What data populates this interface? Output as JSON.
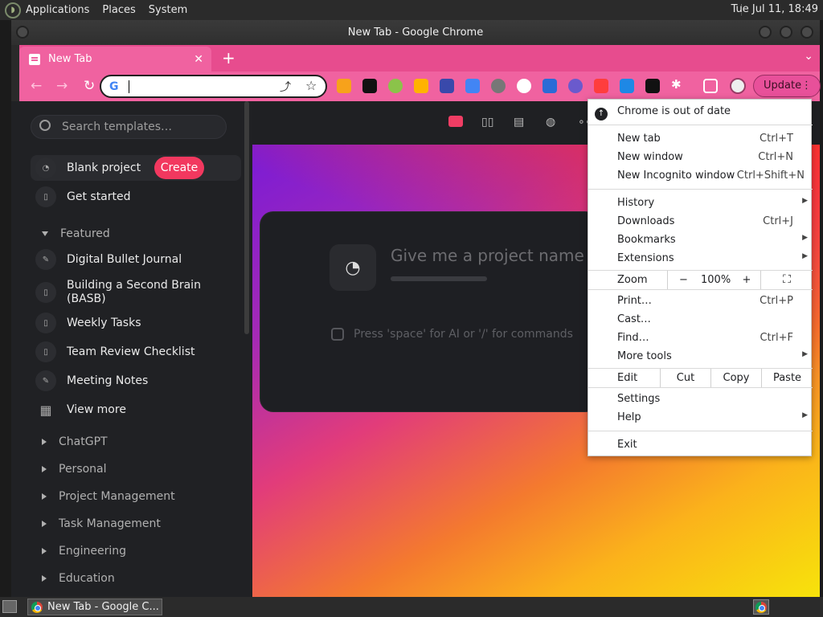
{
  "top_panel": {
    "menus": [
      "Applications",
      "Places",
      "System"
    ],
    "clock": "Tue Jul 11, 18:49"
  },
  "window": {
    "title": "New Tab - Google Chrome"
  },
  "tabs": [
    {
      "label": "New Tab"
    }
  ],
  "toolbar": {
    "omnibox_value": "",
    "update_label": "Update"
  },
  "sidebar": {
    "search_placeholder": "Search templates…",
    "create_label": "Create",
    "items": [
      {
        "label": "Blank project"
      },
      {
        "label": "Get started"
      }
    ],
    "featured_header": "Featured",
    "featured": [
      {
        "label": "Digital Bullet Journal"
      },
      {
        "label": "Building a Second Brain (BASB)"
      },
      {
        "label": "Weekly Tasks"
      },
      {
        "label": "Team Review Checklist"
      },
      {
        "label": "Meeting Notes"
      },
      {
        "label": "View more"
      }
    ],
    "sections": [
      "ChatGPT",
      "Personal",
      "Project Management",
      "Task Management",
      "Engineering",
      "Education"
    ]
  },
  "editor": {
    "name_placeholder": "Give me a project name",
    "hint": "Press 'space' for AI or '/' for commands"
  },
  "chrome_menu": {
    "update_notice": "Chrome is out of date",
    "new_tab": "New tab",
    "new_tab_sc": "Ctrl+T",
    "new_window": "New window",
    "new_window_sc": "Ctrl+N",
    "incognito": "New Incognito window",
    "incognito_sc": "Ctrl+Shift+N",
    "history": "History",
    "downloads": "Downloads",
    "downloads_sc": "Ctrl+J",
    "bookmarks": "Bookmarks",
    "extensions": "Extensions",
    "zoom": "Zoom",
    "zoom_minus": "−",
    "zoom_value": "100%",
    "zoom_plus": "+",
    "print": "Print…",
    "print_sc": "Ctrl+P",
    "cast": "Cast…",
    "find": "Find…",
    "find_sc": "Ctrl+F",
    "more_tools": "More tools",
    "edit": "Edit",
    "cut": "Cut",
    "copy": "Copy",
    "paste": "Paste",
    "settings": "Settings",
    "help": "Help",
    "exit": "Exit"
  },
  "taskbar": {
    "task_label": "New Tab - Google C..."
  }
}
